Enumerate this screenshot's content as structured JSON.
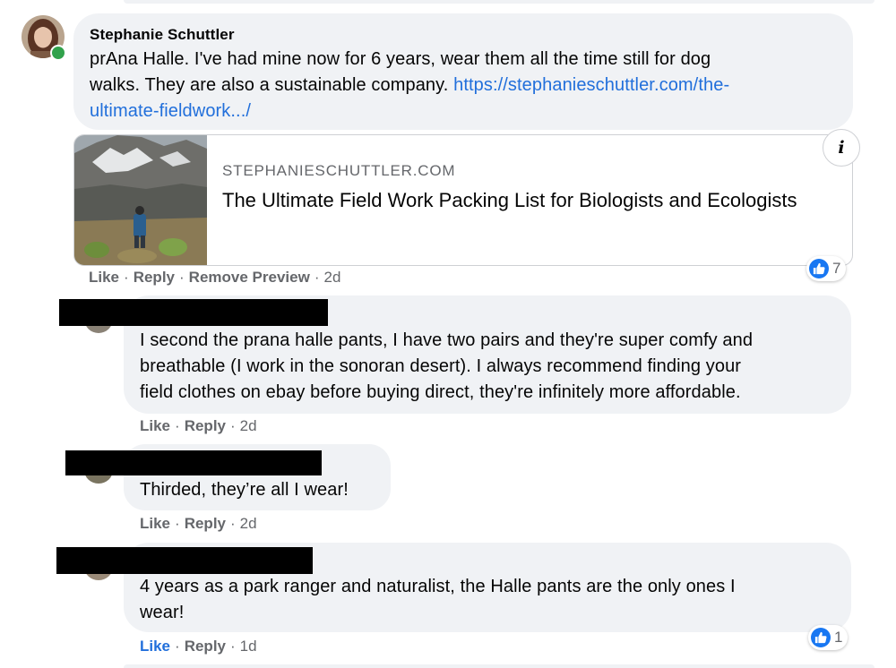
{
  "comments": [
    {
      "author": "Stephanie Schuttler",
      "text_line1": "prAna Halle. I've had mine now for 6 years, wear them all the time still for dog",
      "text_line2_plain": "walks. They are also a sustainable company. ",
      "link_part1": "https://stephanieschuttler.com/the-",
      "link_part2": "ultimate-fieldwork.../",
      "preview": {
        "domain": "STEPHANIESCHUTTLER.COM",
        "title": "The Ultimate Field Work Packing List for Biologists and Ecologists",
        "info_icon": "i"
      },
      "actions": {
        "like": "Like",
        "reply": "Reply",
        "remove_preview": "Remove Preview",
        "time": "2d"
      },
      "reaction": {
        "icon": "thumbs-up-icon",
        "count": "7"
      }
    },
    {
      "lines": [
        "I second the prana halle pants, I have two pairs and they're super comfy and",
        "breathable (I work in the sonoran desert). I always recommend finding your",
        "field clothes on ebay before buying direct, they're infinitely more affordable."
      ],
      "actions": {
        "like": "Like",
        "reply": "Reply",
        "time": "2d"
      }
    },
    {
      "lines": [
        "Thirded, they’re all I wear!"
      ],
      "actions": {
        "like": "Like",
        "reply": "Reply",
        "time": "2d"
      }
    },
    {
      "lines": [
        "4 years as a park ranger and naturalist, the Halle pants are the only ones I",
        "wear!"
      ],
      "actions": {
        "like": "Like",
        "reply": "Reply",
        "time": "1d"
      },
      "reaction": {
        "icon": "thumbs-up-icon",
        "count": "1"
      }
    }
  ],
  "separator": "·",
  "colors": {
    "bubble": "#f0f2f5",
    "link": "#216fdb",
    "meta": "#65676b",
    "like_blue": "#1877f2",
    "online": "#31a24c"
  }
}
